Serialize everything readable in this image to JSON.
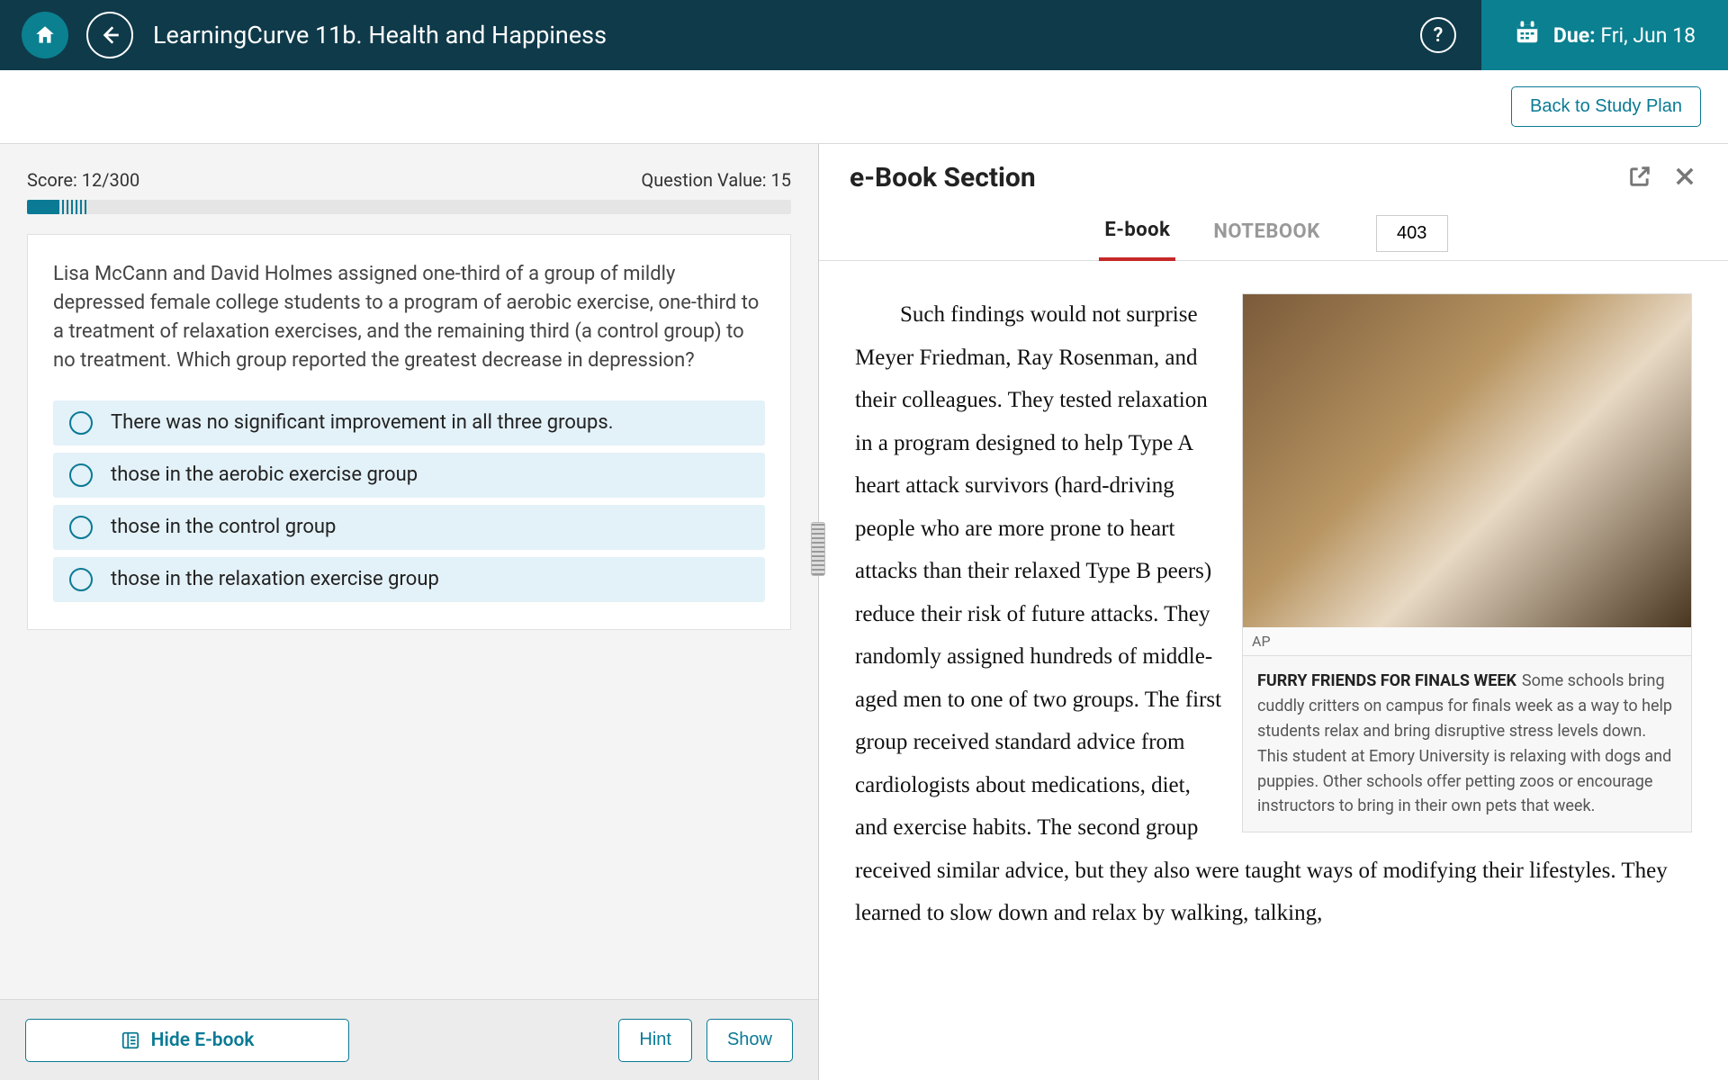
{
  "header": {
    "title": "LearningCurve 11b. Health and Happiness",
    "due_label": "Due:",
    "due_date": "Fri, Jun 18"
  },
  "subbar": {
    "back_to_plan": "Back to Study Plan"
  },
  "quiz": {
    "score_label": "Score: 12/300",
    "question_value_label": "Question Value: 15",
    "progress_pct": 4,
    "question_text": "Lisa McCann and David Holmes assigned one-third of a group of mildly depressed female college students to a program of aerobic exercise, one-third to a treatment of relaxation exercises, and the remaining third (a control group) to no treatment. Which group reported the greatest decrease in depression?",
    "options": [
      "There was no significant improvement in all three groups.",
      "those in the aerobic exercise group",
      "those in the control group",
      "those in the relaxation exercise group"
    ]
  },
  "footer": {
    "hide_ebook": "Hide E-book",
    "hint": "Hint",
    "show": "Show"
  },
  "ebook": {
    "section_title": "e-Book Section",
    "tabs": {
      "ebook": "E-book",
      "notebook": "NOTEBOOK"
    },
    "page_number": "403",
    "image_credit": "AP",
    "caption_title": "FURRY FRIENDS FOR FINALS WEEK",
    "caption_body": "Some schools bring cuddly critters on campus for finals week as a way to help students relax and bring disruptive stress levels down. This student at Emory University is relaxing with dogs and puppies. Other schools offer petting zoos or encourage instructors to bring in their own pets that week.",
    "body_para": "Such findings would not surprise Meyer Friedman, Ray Rosenman, and their colleagues. They tested relaxation in a program designed to help Type A heart attack survivors (hard-driving people who are more prone to heart attacks than their relaxed Type B peers) reduce their risk of future attacks. They randomly assigned hundreds of middle-aged men to one of two groups. The first group received standard advice from cardiologists about medications, diet, and exercise habits. The second group received similar advice, but they also were taught ways of modifying their lifestyles. They learned to slow down and relax by walking, talking,"
  }
}
